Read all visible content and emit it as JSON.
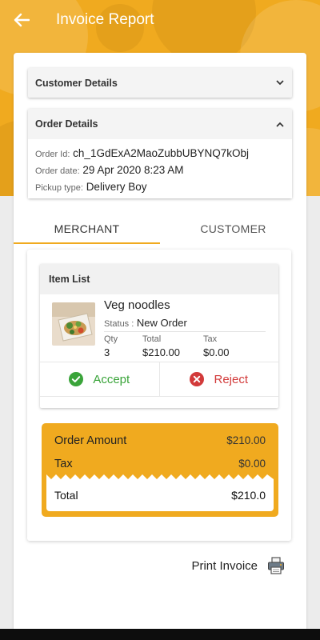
{
  "appbar": {
    "title": "Invoice Report"
  },
  "customer_details": {
    "title": "Customer Details"
  },
  "order_details": {
    "title": "Order Details",
    "order_id_label": "Order Id:",
    "order_id": "ch_1GdExA2MaoZubbUBYNQ7kObj",
    "order_date_label": "Order date:",
    "order_date": "29 Apr 2020 8:23 AM",
    "pickup_type_label": "Pickup type:",
    "pickup_type": "Delivery Boy"
  },
  "tabs": [
    {
      "label": "MERCHANT",
      "active": true
    },
    {
      "label": "CUSTOMER",
      "active": false
    }
  ],
  "item_list": {
    "title": "Item List",
    "item": {
      "name": "Veg noodles",
      "status_label": "Status :",
      "status": "New Order",
      "qty_label": "Qty",
      "qty": "3",
      "total_label": "Total",
      "total": "$210.00",
      "tax_label": "Tax",
      "tax": "$0.00"
    },
    "accept_label": "Accept",
    "reject_label": "Reject"
  },
  "summary": {
    "order_amount_label": "Order Amount",
    "order_amount": "$210.00",
    "tax_label": "Tax",
    "tax": "$0.00",
    "total_label": "Total",
    "total": "$210.0"
  },
  "print": {
    "label": "Print Invoice"
  },
  "colors": {
    "accent": "#f0aa1f",
    "accept": "#3aa43a",
    "reject": "#d23a3a"
  },
  "icons": {
    "back": "arrow-left-icon",
    "expand": "chevron-down-icon",
    "collapse": "chevron-up-icon",
    "accept": "check-circle-icon",
    "reject": "close-circle-icon",
    "print": "printer-icon"
  }
}
